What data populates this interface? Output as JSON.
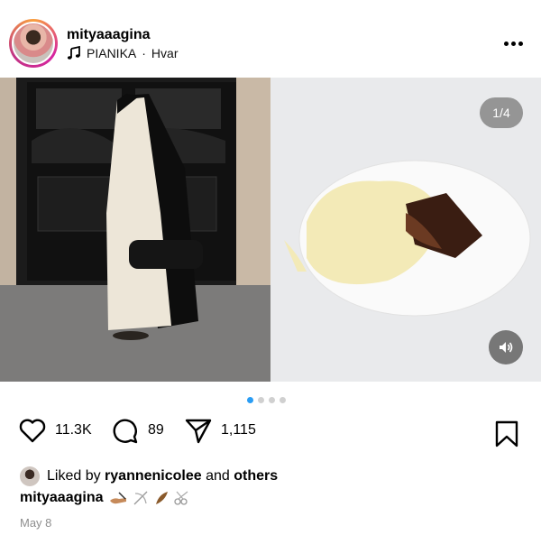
{
  "post": {
    "username": "mityaaagina",
    "music": {
      "artist": "PIANIKA",
      "separator": "·",
      "track": "Hvar"
    },
    "image_counter": "1/4",
    "carousel": {
      "total": 4,
      "active_index": 0
    },
    "likes": "11.3K",
    "comments": "89",
    "shares": "1,115",
    "liked_by": {
      "prefix": "Liked by",
      "user": "ryannenicolee",
      "conj": "and",
      "others": "others"
    },
    "caption_user": "mityaaagina",
    "date": "May 8"
  },
  "colors": {
    "accent": "#2a9df4",
    "muted": "#8e8e8e"
  },
  "icons": [
    "music-note-icon",
    "more-icon",
    "volume-icon",
    "heart-icon",
    "comment-icon",
    "share-icon",
    "bookmark-icon"
  ]
}
